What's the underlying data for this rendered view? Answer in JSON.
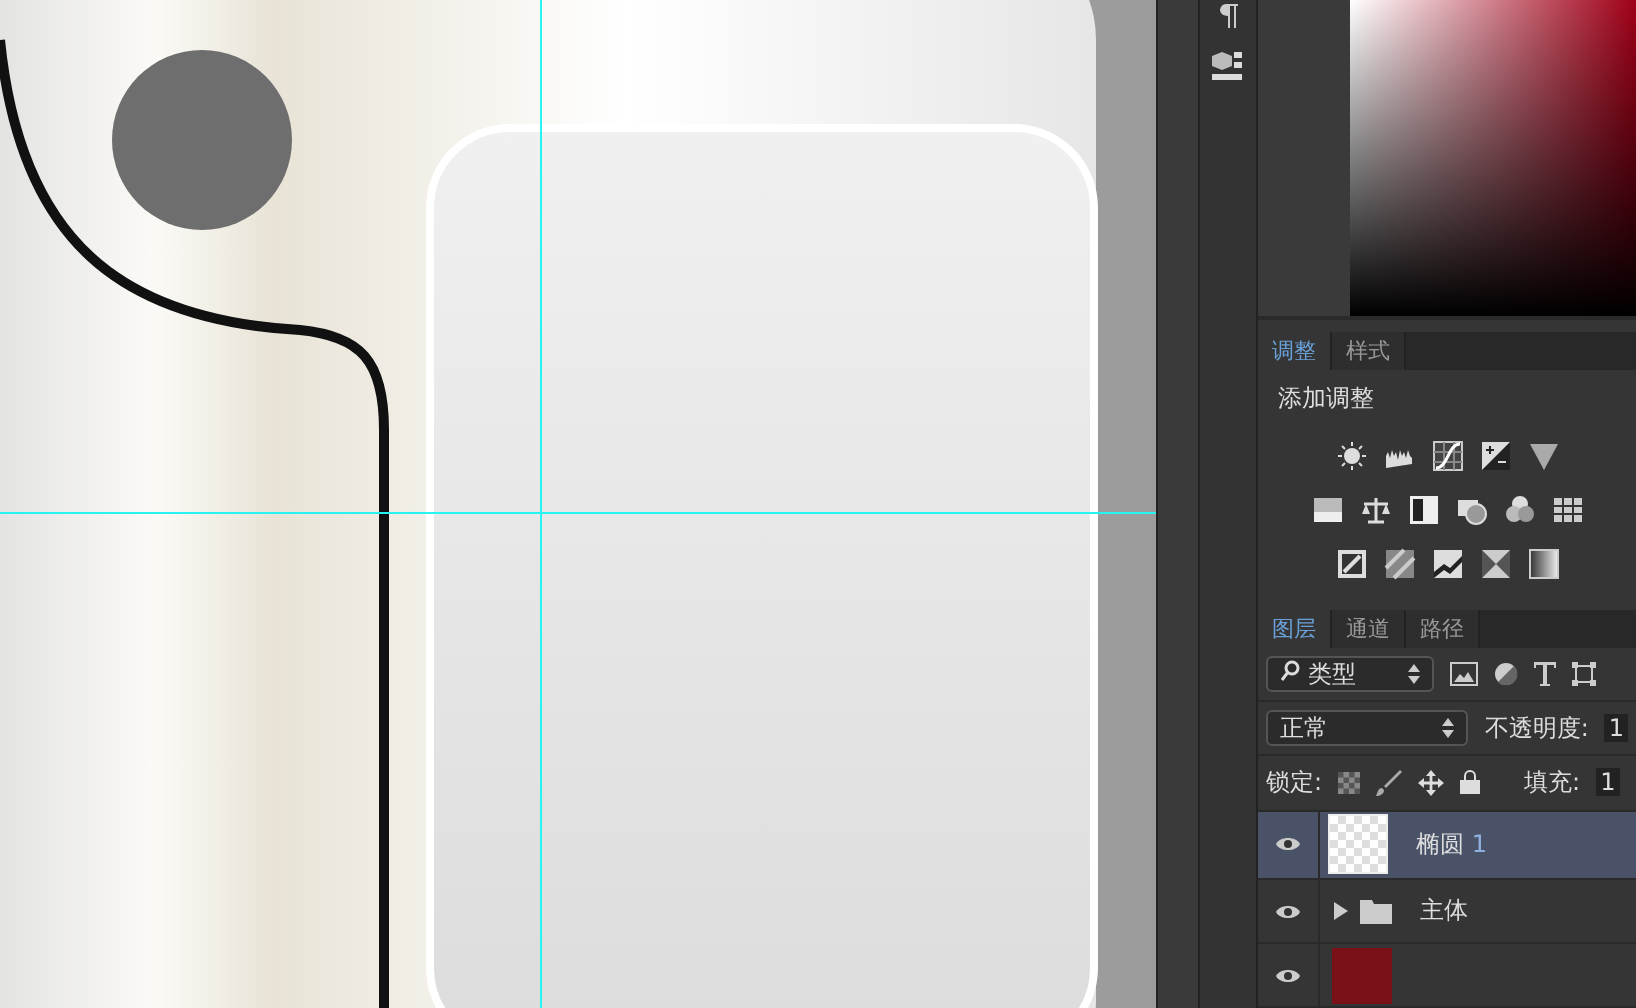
{
  "adjustments_panel": {
    "tabs": [
      {
        "label": "调整",
        "selected": true
      },
      {
        "label": "样式",
        "selected": false
      }
    ],
    "title": "添加调整"
  },
  "layers_panel": {
    "tabs": [
      {
        "label": "图层",
        "selected": true
      },
      {
        "label": "通道",
        "selected": false
      },
      {
        "label": "路径",
        "selected": false
      }
    ],
    "filter": {
      "value": "类型"
    },
    "blend_mode": {
      "value": "正常"
    },
    "opacity": {
      "label": "不透明度:",
      "value": "1"
    },
    "lock": {
      "label": "锁定:"
    },
    "fill": {
      "label": "填充:",
      "value": "1"
    },
    "layers": [
      {
        "kind": "shape",
        "name": "椭圆",
        "suffix": "1",
        "visible": true,
        "selected": true
      },
      {
        "kind": "group",
        "name": "主体",
        "visible": true,
        "selected": false,
        "expanded": false
      },
      {
        "kind": "fill",
        "visible": true,
        "selected": false
      }
    ]
  }
}
